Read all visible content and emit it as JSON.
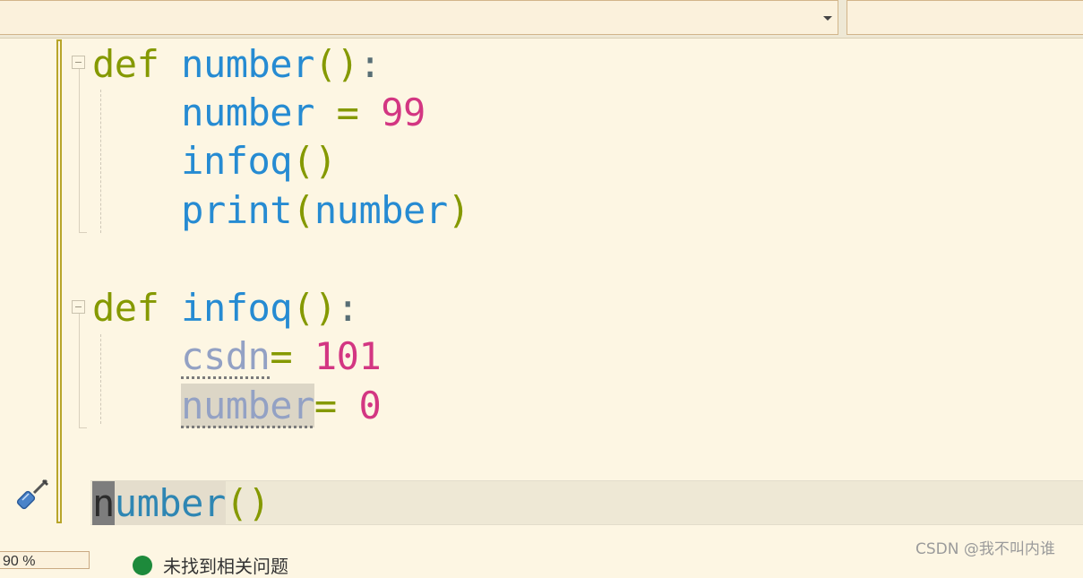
{
  "navbar": {
    "left_combo_value": "",
    "right_combo_value": ""
  },
  "code": {
    "line1": {
      "kw": "def",
      "name": "number",
      "parens": "()",
      "colon": ":"
    },
    "line2": {
      "var": "number",
      "op": " = ",
      "value": "99"
    },
    "line3": {
      "call": "infoq",
      "parens": "()"
    },
    "line4": {
      "fn": "print",
      "open": "(",
      "arg": "number",
      "close": ")"
    },
    "line6": {
      "kw": "def",
      "name": "infoq",
      "parens": "()",
      "colon": ":"
    },
    "line7": {
      "var": "csdn",
      "op": "= ",
      "value": "101"
    },
    "line8": {
      "var": "number",
      "op": "= ",
      "value": "0"
    },
    "line10": {
      "caret_char": "n",
      "rest": "umber",
      "parens": "()"
    }
  },
  "status": {
    "zoom": "90 %",
    "message": "未找到相关问题"
  },
  "watermark": "CSDN @我不叫内谁",
  "colors": {
    "keyword": "#859900",
    "identifier": "#268bd2",
    "number": "#d33682",
    "background": "#fdf6e3"
  }
}
